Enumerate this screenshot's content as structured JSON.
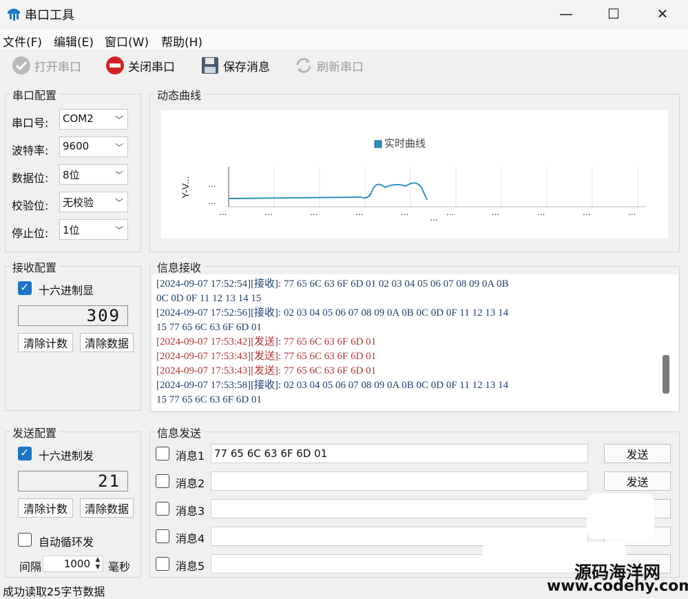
{
  "window": {
    "title": "串口工具",
    "min": "—",
    "max": "☐",
    "close": "✕"
  },
  "menu": [
    "文件(F)",
    "编辑(E)",
    "窗口(W)",
    "帮助(H)"
  ],
  "toolbar": {
    "open": "打开串口",
    "close": "关闭串口",
    "save": "保存消息",
    "refresh": "刷新串口"
  },
  "serial": {
    "title": "串口配置",
    "port_label": "串口号:",
    "port_value": "COM2",
    "baud_label": "波特率:",
    "baud_value": "9600",
    "data_label": "数据位:",
    "data_value": "8位",
    "parity_label": "校验位:",
    "parity_value": "无校验",
    "stop_label": "停止位:",
    "stop_value": "1位"
  },
  "chart": {
    "title": "动态曲线",
    "legend": "实时曲线",
    "ylabel": "Y-V...",
    "ytick": "...",
    "xtick": "...",
    "xlabel": "...",
    "color": "#2e8fc0"
  },
  "receive_cfg": {
    "title": "接收配置",
    "hex_label": "十六进制显",
    "count": "309",
    "clear_count": "清除计数",
    "clear_data": "清除数据"
  },
  "receive_log": {
    "title": "信息接收",
    "lines": [
      {
        "type": "recv",
        "text": "[2024-09-07 17:52:54][接收]: 77 65 6C 63 6F 6D 01 02 03 04 05 06 07 08 09 0A 0B"
      },
      {
        "type": "recv",
        "text": "0C 0D 0F 11 12 13 14 15"
      },
      {
        "type": "recv",
        "text": "[2024-09-07 17:52:56][接收]: 02 03 04 05 06 07 08 09 0A 0B 0C 0D 0F 11 12 13 14"
      },
      {
        "type": "recv",
        "text": "15 77 65 6C 63 6F 6D 01"
      },
      {
        "type": "send",
        "text": "[2024-09-07 17:53:42][发送]: 77 65 6C 63 6F 6D 01"
      },
      {
        "type": "send",
        "text": "[2024-09-07 17:53:43][发送]: 77 65 6C 63 6F 6D 01"
      },
      {
        "type": "send",
        "text": "[2024-09-07 17:53:43][发送]: 77 65 6C 63 6F 6D 01"
      },
      {
        "type": "recv",
        "text": "[2024-09-07 17:53:58][接收]: 02 03 04 05 06 07 08 09 0A 0B 0C 0D 0F 11 12 13 14"
      },
      {
        "type": "recv",
        "text": "15 77 65 6C 63 6F 6D 01"
      }
    ]
  },
  "send_cfg": {
    "title": "发送配置",
    "hex_label": "十六进制发",
    "count": "21",
    "clear_count": "清除计数",
    "clear_data": "清除数据",
    "auto_label": "自动循环发",
    "interval_label": "间隔",
    "interval_value": "1000",
    "unit": "毫秒"
  },
  "send_msgs": {
    "title": "信息发送",
    "send_label": "发送",
    "items": [
      {
        "label": "消息1",
        "value": "77 65 6C 63 6F 6D 01"
      },
      {
        "label": "消息2",
        "value": ""
      },
      {
        "label": "消息3",
        "value": ""
      },
      {
        "label": "消息4",
        "value": ""
      },
      {
        "label": "消息5",
        "value": ""
      }
    ]
  },
  "status": "成功读取25字节数据",
  "watermark": {
    "line1": "源码海洋网",
    "line2": "www.codehy.com"
  }
}
